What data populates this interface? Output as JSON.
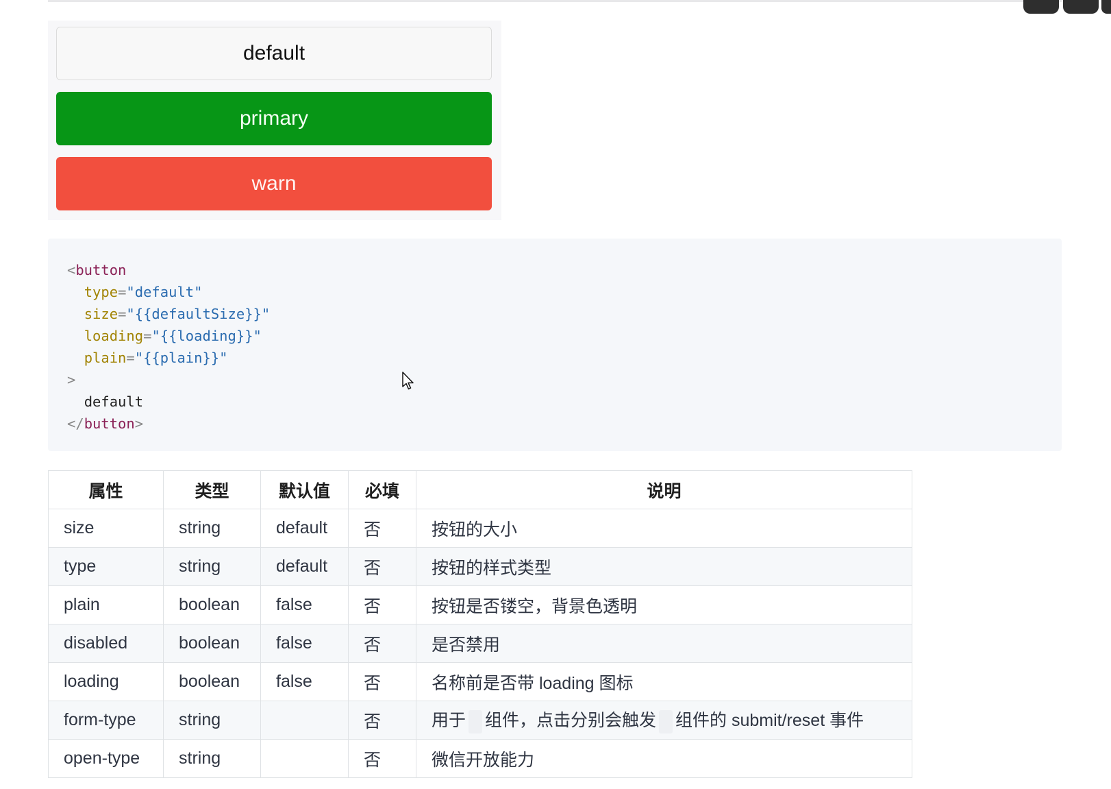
{
  "demo": {
    "buttons": [
      {
        "label": "default",
        "type": "default"
      },
      {
        "label": "primary",
        "type": "primary"
      },
      {
        "label": "warn",
        "type": "warn"
      }
    ],
    "colors": {
      "primary": "#079616",
      "warn": "#f24f3e",
      "default": "#f8f8f8"
    }
  },
  "code": {
    "lines": [
      {
        "open": "<",
        "tag": "button"
      },
      {
        "attr": "type",
        "value": "\"default\""
      },
      {
        "attr": "size",
        "value": "\"{{defaultSize}}\""
      },
      {
        "attr": "loading",
        "value": "\"{{loading}}\""
      },
      {
        "attr": "plain",
        "value": "\"{{plain}}\""
      },
      {
        "close": ">"
      },
      {
        "text": "default"
      },
      {
        "open": "</",
        "tag": "button",
        "close": ">"
      }
    ]
  },
  "table": {
    "headers": [
      "属性",
      "类型",
      "默认值",
      "必填",
      "说明"
    ],
    "rows": [
      [
        "size",
        "string",
        "default",
        "否",
        "按钮的大小"
      ],
      [
        "type",
        "string",
        "default",
        "否",
        "按钮的样式类型"
      ],
      [
        "plain",
        "boolean",
        "false",
        "否",
        "按钮是否镂空，背景色透明"
      ],
      [
        "disabled",
        "boolean",
        "false",
        "否",
        "是否禁用"
      ],
      [
        "loading",
        "boolean",
        "false",
        "否",
        "名称前是否带 loading 图标"
      ],
      [
        "form-type",
        "string",
        "",
        "否",
        [
          "用于",
          "组件，点击分别会触发",
          "组件的 submit/reset 事件"
        ]
      ],
      [
        "open-type",
        "string",
        "",
        "否",
        "微信开放能力"
      ]
    ]
  }
}
